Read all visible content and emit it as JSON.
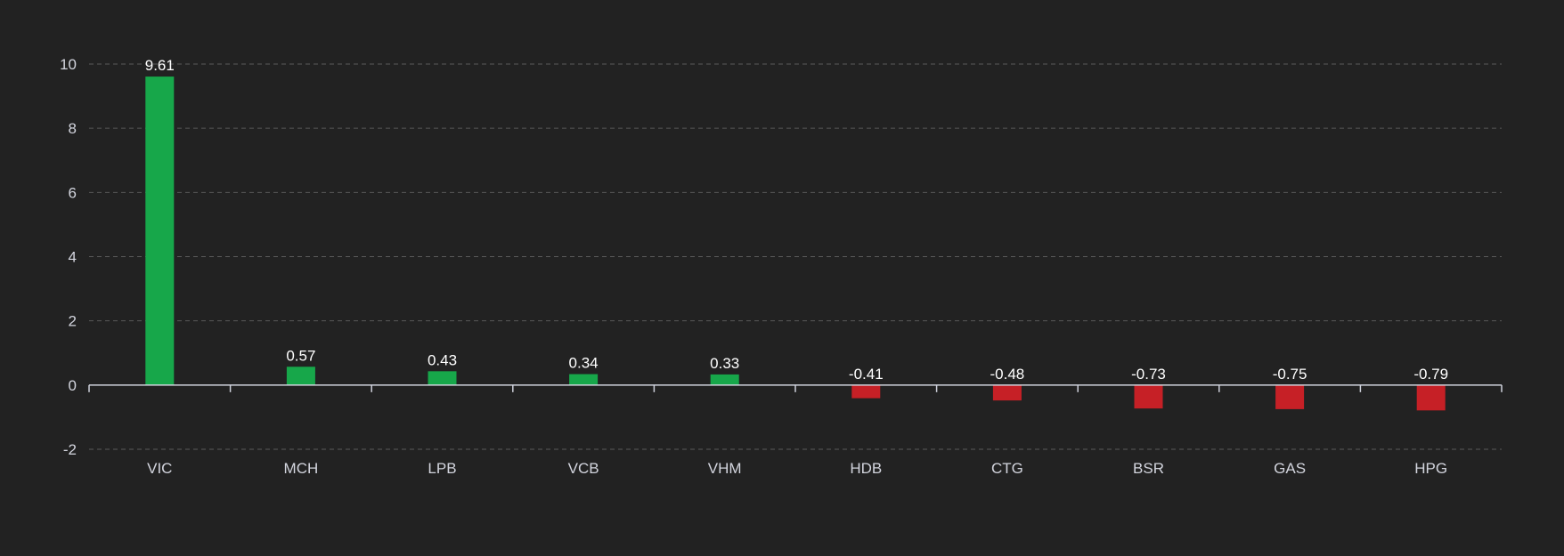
{
  "colors": {
    "background": "#222222",
    "positive": "#17a74a",
    "negative": "#c62026",
    "grid": "#5a5a5a",
    "axis": "#cfd2dc",
    "tick_text": "#d3d5de",
    "label_text": "#ffffff"
  },
  "chart_data": {
    "type": "bar",
    "title": "",
    "xlabel": "",
    "ylabel": "",
    "categories": [
      "VIC",
      "MCH",
      "LPB",
      "VCB",
      "VHM",
      "HDB",
      "CTG",
      "BSR",
      "GAS",
      "HPG"
    ],
    "values": [
      9.61,
      0.57,
      0.43,
      0.34,
      0.33,
      -0.41,
      -0.48,
      -0.73,
      -0.75,
      -0.79
    ],
    "data_labels": [
      "9.61",
      "0.57",
      "0.43",
      "0.34",
      "0.33",
      "-0.41",
      "-0.48",
      "-0.73",
      "-0.75",
      "-0.79"
    ],
    "ylim": [
      -2,
      10
    ],
    "yticks": [
      -2,
      0,
      2,
      4,
      6,
      8,
      10
    ],
    "ytick_labels": [
      "-2",
      "0",
      "2",
      "4",
      "6",
      "8",
      "10"
    ],
    "grid": true,
    "grid_style": "dashed",
    "legend": "none"
  }
}
